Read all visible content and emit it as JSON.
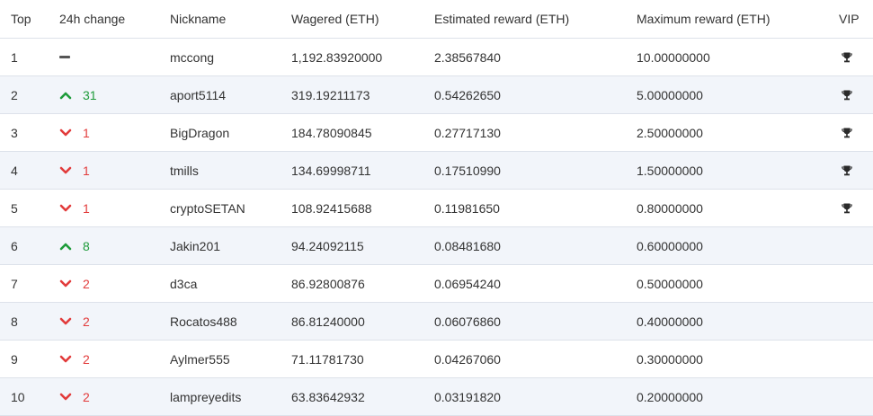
{
  "columns": {
    "top": "Top",
    "change": "24h change",
    "nickname": "Nickname",
    "wagered": "Wagered (ETH)",
    "estimated": "Estimated reward (ETH)",
    "maximum": "Maximum reward (ETH)",
    "vip": "VIP"
  },
  "colors": {
    "up": "#1e9b3a",
    "down": "#e23b3b",
    "neutral": "#555555",
    "row_alt": "#f2f5fa",
    "border": "#dde2ea"
  },
  "rows": [
    {
      "rank": "1",
      "direction": "none",
      "change": "",
      "nickname": "mccong",
      "wagered": "1,192.83920000",
      "estimated": "2.38567840",
      "maximum": "10.00000000",
      "vip": true,
      "icon": "dash-icon"
    },
    {
      "rank": "2",
      "direction": "up",
      "change": "31",
      "nickname": "aport5114",
      "wagered": "319.19211173",
      "estimated": "0.54262650",
      "maximum": "5.00000000",
      "vip": true,
      "icon": "chevron-up-icon"
    },
    {
      "rank": "3",
      "direction": "down",
      "change": "1",
      "nickname": "BigDragon",
      "wagered": "184.78090845",
      "estimated": "0.27717130",
      "maximum": "2.50000000",
      "vip": true,
      "icon": "chevron-down-icon"
    },
    {
      "rank": "4",
      "direction": "down",
      "change": "1",
      "nickname": "tmills",
      "wagered": "134.69998711",
      "estimated": "0.17510990",
      "maximum": "1.50000000",
      "vip": true,
      "icon": "chevron-down-icon"
    },
    {
      "rank": "5",
      "direction": "down",
      "change": "1",
      "nickname": "cryptoSETAN",
      "wagered": "108.92415688",
      "estimated": "0.11981650",
      "maximum": "0.80000000",
      "vip": true,
      "icon": "chevron-down-icon"
    },
    {
      "rank": "6",
      "direction": "up",
      "change": "8",
      "nickname": "Jakin201",
      "wagered": "94.24092115",
      "estimated": "0.08481680",
      "maximum": "0.60000000",
      "vip": false,
      "icon": "chevron-up-icon"
    },
    {
      "rank": "7",
      "direction": "down",
      "change": "2",
      "nickname": "d3ca",
      "wagered": "86.92800876",
      "estimated": "0.06954240",
      "maximum": "0.50000000",
      "vip": false,
      "icon": "chevron-down-icon"
    },
    {
      "rank": "8",
      "direction": "down",
      "change": "2",
      "nickname": "Rocatos488",
      "wagered": "86.81240000",
      "estimated": "0.06076860",
      "maximum": "0.40000000",
      "vip": false,
      "icon": "chevron-down-icon"
    },
    {
      "rank": "9",
      "direction": "down",
      "change": "2",
      "nickname": "Aylmer555",
      "wagered": "71.11781730",
      "estimated": "0.04267060",
      "maximum": "0.30000000",
      "vip": false,
      "icon": "chevron-down-icon"
    },
    {
      "rank": "10",
      "direction": "down",
      "change": "2",
      "nickname": "lampreyedits",
      "wagered": "63.83642932",
      "estimated": "0.03191820",
      "maximum": "0.20000000",
      "vip": false,
      "icon": "chevron-down-icon"
    }
  ]
}
